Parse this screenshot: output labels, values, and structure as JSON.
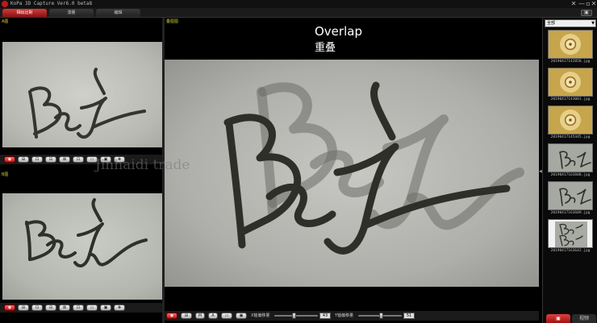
{
  "app": {
    "title": "KoPa 3D Capture Ver6.0 beta8",
    "controls": [
      "✕",
      "—",
      "▫",
      "✕"
    ]
  },
  "tabs": [
    {
      "label": "相似比對",
      "active": true
    },
    {
      "label": "測量",
      "active": false
    },
    {
      "label": "编辑",
      "active": false
    }
  ],
  "panels": {
    "a_label": "A图",
    "b_label": "B图",
    "main_label": "叠图图"
  },
  "overlay": {
    "title": "Overlap",
    "subtitle": "重叠"
  },
  "watermark": "Jinhaidi trade",
  "small_toolbar_icons": [
    "◉",
    "⊞",
    "⊡",
    "⊟",
    "⊠",
    "⊡",
    "▭",
    "▣",
    "✚"
  ],
  "main_toolbar": {
    "icons": [
      "◉",
      "⊞",
      "M",
      "A",
      "▭",
      "▣"
    ],
    "label_x": "X轴偏移量",
    "value_x": "43",
    "label_y": "Y轴偏移量",
    "value_y": "51"
  },
  "sidebar": {
    "filter": "全部",
    "thumbnails": [
      {
        "kind": "coin",
        "caption": "20190417142858.jpg"
      },
      {
        "kind": "coin",
        "caption": "20190417143001.jpg"
      },
      {
        "kind": "coin",
        "caption": "20190417145445.jpg"
      },
      {
        "kind": "sig",
        "caption": "20190417163608.jpg"
      },
      {
        "kind": "sig",
        "caption": "20190417163609.jpg"
      },
      {
        "kind": "doc",
        "caption": "20190417163642.jpg"
      }
    ],
    "bottom_tabs": [
      {
        "label": "▣",
        "active": true
      },
      {
        "label": "视频",
        "active": false
      }
    ]
  },
  "colors": {
    "accent": "#c0181e",
    "ink": "#2e2f28"
  }
}
